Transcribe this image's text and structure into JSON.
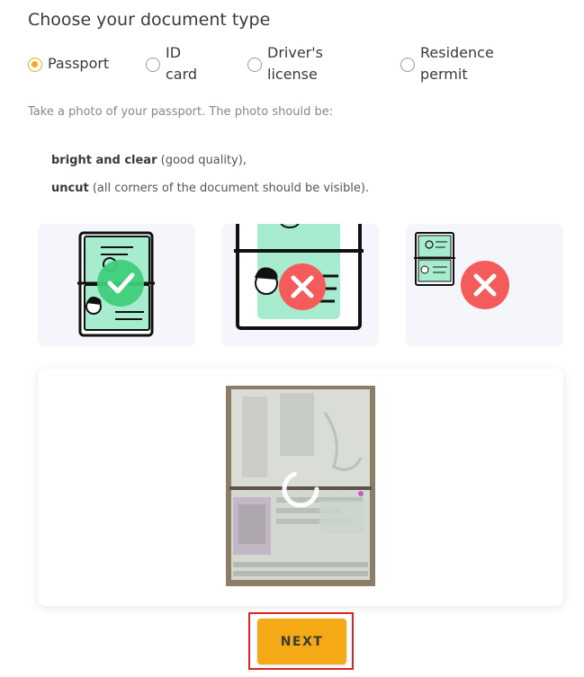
{
  "page": {
    "title": "Choose your document type"
  },
  "document_types": [
    {
      "line1": "Passport",
      "line2": "",
      "selected": true
    },
    {
      "line1": "ID",
      "line2": "card",
      "selected": false
    },
    {
      "line1": "Driver's",
      "line2": "license",
      "selected": false
    },
    {
      "line1": "Residence",
      "line2": "permit",
      "selected": false
    }
  ],
  "instructions": {
    "intro": "Take a photo of your passport. The photo should be:",
    "req1_bold": "bright and clear",
    "req1_rest": " (good quality),",
    "req2_bold": "uncut",
    "req2_rest": " (all corners of the document should be visible)."
  },
  "examples": [
    {
      "icon": "check-icon",
      "state": "correct"
    },
    {
      "icon": "cross-icon",
      "state": "too-close"
    },
    {
      "icon": "cross-icon",
      "state": "too-far"
    }
  ],
  "colors": {
    "accent": "#f5a914",
    "good": "#3ecf7a",
    "bad": "#f45b5b",
    "doc_fill": "#a8ecd0",
    "highlight_border": "#e02424"
  },
  "buttons": {
    "next_label": "NEXT"
  }
}
